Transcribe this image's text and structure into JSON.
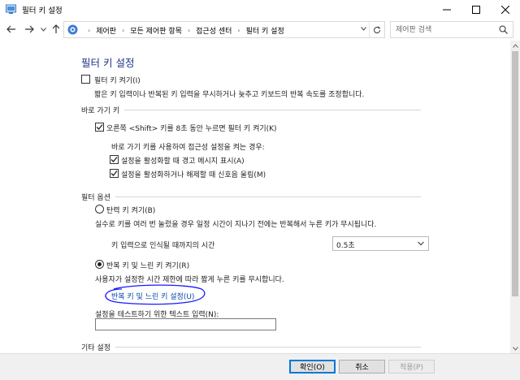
{
  "window": {
    "title": "필터 키 설정"
  },
  "address": {
    "crumbs": [
      "제어판",
      "모든 제어판 항목",
      "접근성 센터",
      "필터 키 설정"
    ],
    "search_placeholder": "제어판 검색"
  },
  "page": {
    "title": "필터 키 설정",
    "filter_keys_toggle": {
      "label": "필터 키 켜기(I)",
      "checked": false
    },
    "filter_keys_desc": "짧은 키 입력이나 반복된 키 입력을 무시하거나 늦추고 키보드의 반복 속도를 조정합니다.",
    "shortcut_section": "바로 가기 키",
    "shortcut_toggle": {
      "label": "오른쪽 <Shift> 키를 8초 동안 누르면 필터 키 켜기(K)",
      "checked": true
    },
    "shortcut_when": "바로 가기 키를 사용하여 접근성 설정을 켜는 경우:",
    "warning_msg": {
      "label": "설정을 활성화할 때 경고 메시지 표시(A)",
      "checked": true
    },
    "sound_msg": {
      "label": "설정을 활성화하거나 해제할 때 신호음 울림(M)",
      "checked": true
    },
    "filter_options_section": "필터 옵션",
    "bounce_keys": {
      "label": "탄력 키 켜기(B)",
      "selected": false
    },
    "bounce_desc": "실수로 키를 여러 번 눌렀을 경우 일정 시간이 지나기 전에는 반복해서 누른 키가 무시됩니다.",
    "bounce_time_label": "키 입력으로 인식될 때까지의 시간",
    "bounce_time_value": "0.5초",
    "repeat_keys": {
      "label": "반복 키 및 느린 키 켜기(R)",
      "selected": true
    },
    "repeat_desc": "사용자가 설정한 시간 제한에 따라 짧게 누른 키를 무시합니다.",
    "repeat_link": "반복 키 및 느린 키 설정(U)",
    "test_label": "설정을 테스트하기 위한 텍스트 입력(N):",
    "test_value": "",
    "other_section": "기타 설정"
  },
  "footer": {
    "ok": "확인(O)",
    "cancel": "취소",
    "apply": "적용(P)"
  },
  "colors": {
    "title_blue": "#1e3287",
    "link_blue": "#0645ad",
    "annotation_ink": "#1a1aff"
  }
}
